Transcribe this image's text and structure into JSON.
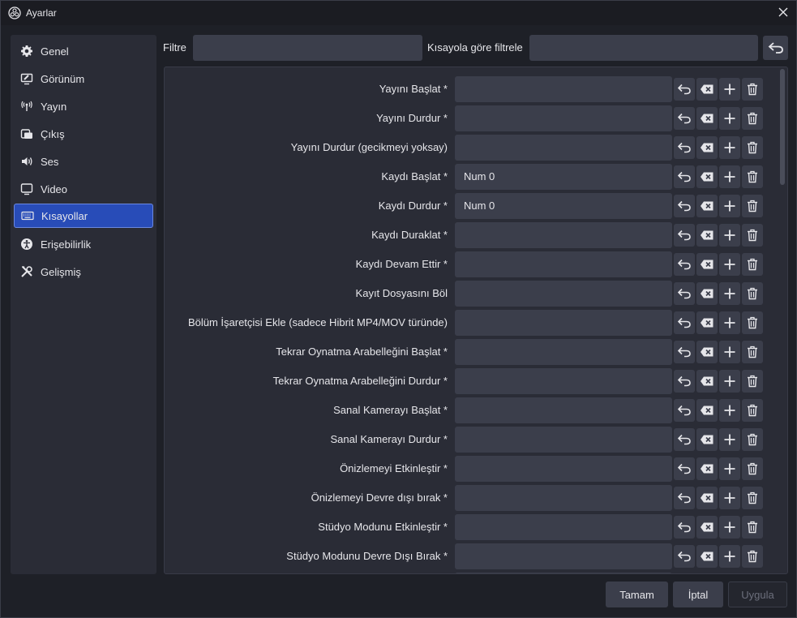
{
  "window": {
    "title": "Ayarlar"
  },
  "sidebar": {
    "items": [
      {
        "label": "Genel",
        "icon": "gear-icon",
        "active": false
      },
      {
        "label": "Görünüm",
        "icon": "appearance-icon",
        "active": false
      },
      {
        "label": "Yayın",
        "icon": "antenna-icon",
        "active": false
      },
      {
        "label": "Çıkış",
        "icon": "output-icon",
        "active": false
      },
      {
        "label": "Ses",
        "icon": "speaker-icon",
        "active": false
      },
      {
        "label": "Video",
        "icon": "monitor-icon",
        "active": false
      },
      {
        "label": "Kısayollar",
        "icon": "keyboard-icon",
        "active": true
      },
      {
        "label": "Erişebilirlik",
        "icon": "accessibility-icon",
        "active": false
      },
      {
        "label": "Gelişmiş",
        "icon": "tools-icon",
        "active": false
      }
    ]
  },
  "filters": {
    "filter_label": "Filtre",
    "filter_value": "",
    "shortcut_filter_label": "Kısayola göre filtrele",
    "shortcut_filter_value": ""
  },
  "hotkeys": [
    {
      "label": "Yayını Başlat *",
      "value": ""
    },
    {
      "label": "Yayını Durdur *",
      "value": ""
    },
    {
      "label": "Yayını Durdur (gecikmeyi yoksay)",
      "value": ""
    },
    {
      "label": "Kaydı Başlat *",
      "value": "Num 0"
    },
    {
      "label": "Kaydı Durdur *",
      "value": "Num 0"
    },
    {
      "label": "Kaydı Duraklat *",
      "value": ""
    },
    {
      "label": "Kaydı Devam Ettir *",
      "value": ""
    },
    {
      "label": "Kayıt Dosyasını Böl",
      "value": ""
    },
    {
      "label": "Bölüm İşaretçisi Ekle (sadece Hibrit MP4/MOV türünde)",
      "value": ""
    },
    {
      "label": "Tekrar Oynatma Arabelleğini Başlat *",
      "value": ""
    },
    {
      "label": "Tekrar Oynatma Arabelleğini Durdur *",
      "value": ""
    },
    {
      "label": "Sanal Kamerayı Başlat *",
      "value": ""
    },
    {
      "label": "Sanal Kamerayı Durdur *",
      "value": ""
    },
    {
      "label": "Önizlemeyi Etkinleştir *",
      "value": ""
    },
    {
      "label": "Önizlemeyi Devre dışı bırak *",
      "value": ""
    },
    {
      "label": "Stüdyo Modunu Etkinleştir *",
      "value": ""
    },
    {
      "label": "Stüdyo Modunu Devre Dışı Bırak *",
      "value": ""
    },
    {
      "label": "",
      "value": ""
    }
  ],
  "footer": {
    "ok_label": "Tamam",
    "cancel_label": "İptal",
    "apply_label": "Uygula"
  },
  "colors": {
    "accent": "#284cb8",
    "background": "#1e2027",
    "panel": "#2a2c36",
    "input": "#3b3e4b"
  }
}
